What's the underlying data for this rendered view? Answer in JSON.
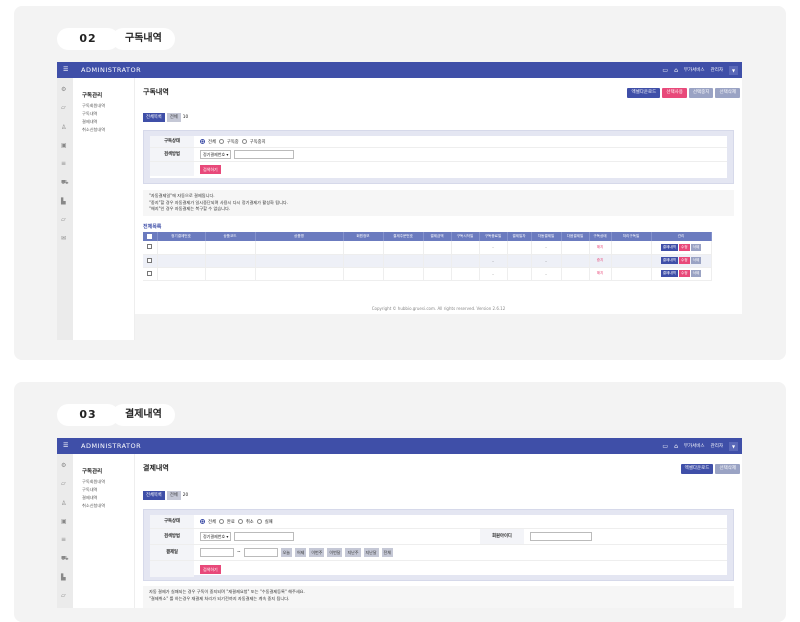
{
  "sections": [
    {
      "number": "02",
      "title": "구독내역",
      "app": {
        "brand": "ADMINISTRATOR",
        "top_links": [
          "부가서비스",
          "관리자"
        ],
        "menu": {
          "heading": "구독관리",
          "items": [
            "구독회원내역",
            "구독내역",
            "결제내역",
            "취소신청내역"
          ]
        },
        "page_title": "구독내역",
        "toolbar": [
          {
            "label": "엑셀다운로드",
            "style": "navy"
          },
          {
            "label": "선택사용",
            "style": "pink"
          },
          {
            "label": "선택중지",
            "style": "gray"
          },
          {
            "label": "선택삭제",
            "style": "gray"
          }
        ],
        "tabs": {
          "active": "전체목록",
          "second": "전체",
          "count": "10"
        },
        "search": {
          "status_label": "구독상태",
          "status_options": [
            "전체",
            "구독중",
            "구독중지"
          ],
          "method_label": "검색방법",
          "method_select": "정기결제번호",
          "search_button": "검색하기"
        },
        "notes": [
          "\"자동결제일\"에 자동으로 결제됩니다.",
          "\"중지\"할 경우 자동결제가 일시중단되며 사용시 다시 정기결제가 활성화 됩니다.",
          "\"해지\"인 경우 자동결제는 복구할 수 없습니다."
        ],
        "list_title": "전체목록",
        "table": {
          "headers": [
            "",
            "정기결제번호",
            "상품코드",
            "상품명",
            "회원정보",
            "결제주문번호",
            "결제금액",
            "구독시작일",
            "구독종료일",
            "결제일자",
            "자동결제일",
            "다음결제일",
            "구독상태",
            "처리구독일",
            "관리"
          ],
          "rows": [
            {
              "end": "-",
              "next": "-",
              "status": "해지"
            },
            {
              "end": "-",
              "next": "-",
              "status": "중지"
            },
            {
              "end": "-",
              "next": "-",
              "status": "해지"
            }
          ],
          "row_actions": [
            "결제내역",
            "수정",
            "삭제"
          ]
        },
        "footer": "Copyright © hubbio.gruesi.com. All rights reserved. Version 2.6.12"
      }
    },
    {
      "number": "03",
      "title": "결제내역",
      "app": {
        "brand": "ADMINISTRATOR",
        "top_links": [
          "부가서비스",
          "관리자"
        ],
        "menu": {
          "heading": "구독관리",
          "items": [
            "구독회원내역",
            "구독내역",
            "결제내역",
            "취소신청내역"
          ]
        },
        "page_title": "결제내역",
        "toolbar": [
          {
            "label": "엑셀다운로드",
            "style": "navy"
          },
          {
            "label": "선택삭제",
            "style": "gray"
          }
        ],
        "tabs": {
          "active": "전체목록",
          "second": "전체",
          "count": "20"
        },
        "search": {
          "status_label": "구독상태",
          "status_options": [
            "전체",
            "완료",
            "취소",
            "실패"
          ],
          "method_label": "검색방법",
          "method_select": "정기결제번호",
          "member_id_label": "회원아이디",
          "date_label": "결제일",
          "date_sep": "~",
          "date_buttons": [
            "오늘",
            "어제",
            "이번주",
            "이번달",
            "지난주",
            "지난달",
            "전체"
          ],
          "search_button": "검색하기"
        },
        "notes": [
          "자동 결제가 실패되는 경우 구독이 중지되며 \"재결제요청\" 또는 \"수동결제등록\" 해주세요.",
          "\"결제취소\" 를 하는경우 재결제 처리가 되기전까지 자동결제는 계속 중지 됩니다."
        ]
      }
    }
  ]
}
